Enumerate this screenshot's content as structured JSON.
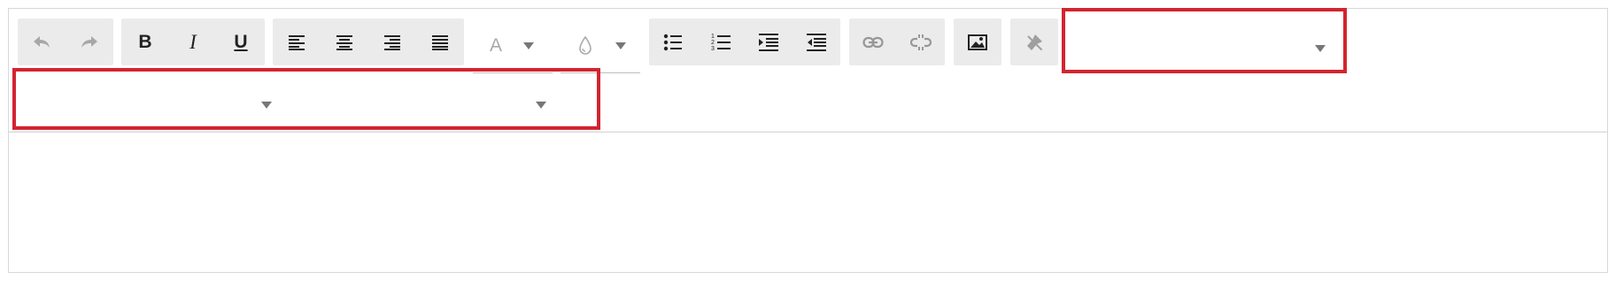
{
  "toolbar": {
    "history": {
      "undo_icon": "undo-icon",
      "redo_icon": "redo-icon"
    },
    "text_style": {
      "bold_label": "B",
      "italic_label": "I",
      "underline_label": "U"
    },
    "alignment": [
      "align-left-icon",
      "align-center-icon",
      "align-right-icon",
      "align-justify-icon"
    ],
    "font_color": {
      "label": "A"
    },
    "background_color": {
      "icon": "droplet-icon"
    },
    "lists": [
      "bulleted-list-icon",
      "numbered-list-icon",
      "indent-icon",
      "outdent-icon"
    ],
    "links": [
      "link-icon",
      "unlink-icon"
    ],
    "image": {
      "icon": "image-icon"
    },
    "clear_format": {
      "icon": "clear-format-icon"
    },
    "dropdowns": {
      "block_format": {
        "value": ""
      },
      "font_family": {
        "value": ""
      },
      "font_size": {
        "value": ""
      }
    }
  },
  "colors": {
    "highlight": "#d32430",
    "group_background": "#ebebeb",
    "icon": "#222222"
  }
}
